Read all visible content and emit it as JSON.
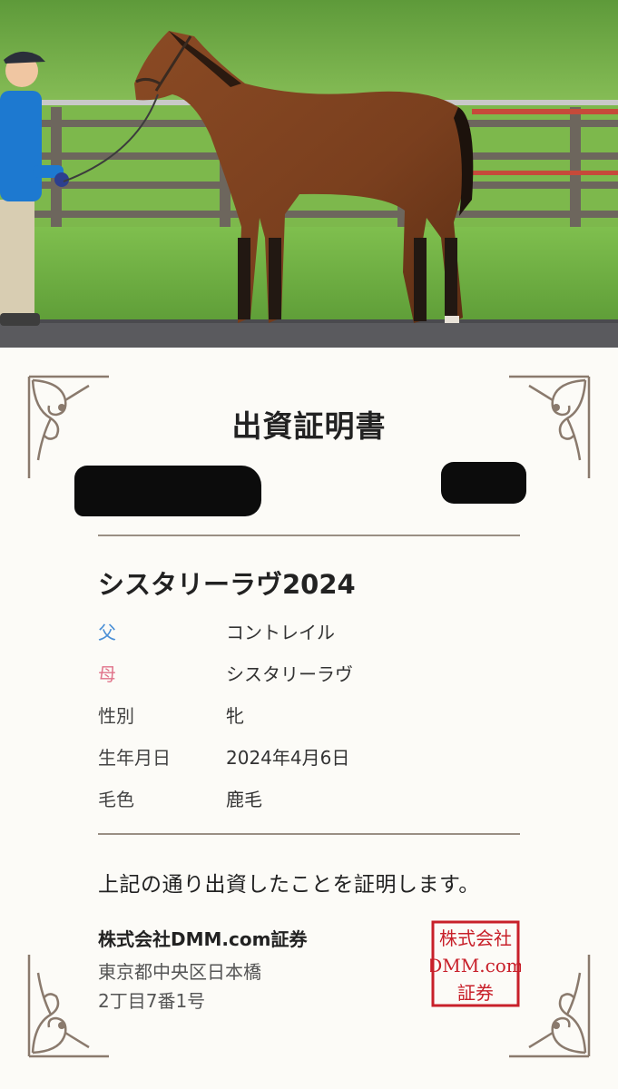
{
  "photo": {
    "description_icon": "horse-photo"
  },
  "certificate": {
    "title": "出資証明書",
    "horse_name": "シスタリーラヴ2024",
    "rows": [
      {
        "label": "父",
        "value": "コントレイル",
        "label_color": "#4a8fd6"
      },
      {
        "label": "母",
        "value": "シスタリーラヴ",
        "label_color": "#e0738a"
      },
      {
        "label": "性別",
        "value": "牝",
        "label_color": "#444444"
      },
      {
        "label": "生年月日",
        "value": "2024年4月6日",
        "label_color": "#444444"
      },
      {
        "label": "毛色",
        "value": "鹿毛",
        "label_color": "#444444"
      }
    ],
    "statement": "上記の通り出資したことを証明します。",
    "company": "株式会社DMM.com証券",
    "address_line1": "東京都中央区日本橋",
    "address_line2": "2丁目7番1号",
    "seal": {
      "line1": "株式会社",
      "line2": "DMM.com",
      "line3": "証券",
      "color": "#c8202a"
    }
  },
  "colors": {
    "rule": "#9a8f84",
    "ornament": "#8a7a6d"
  }
}
